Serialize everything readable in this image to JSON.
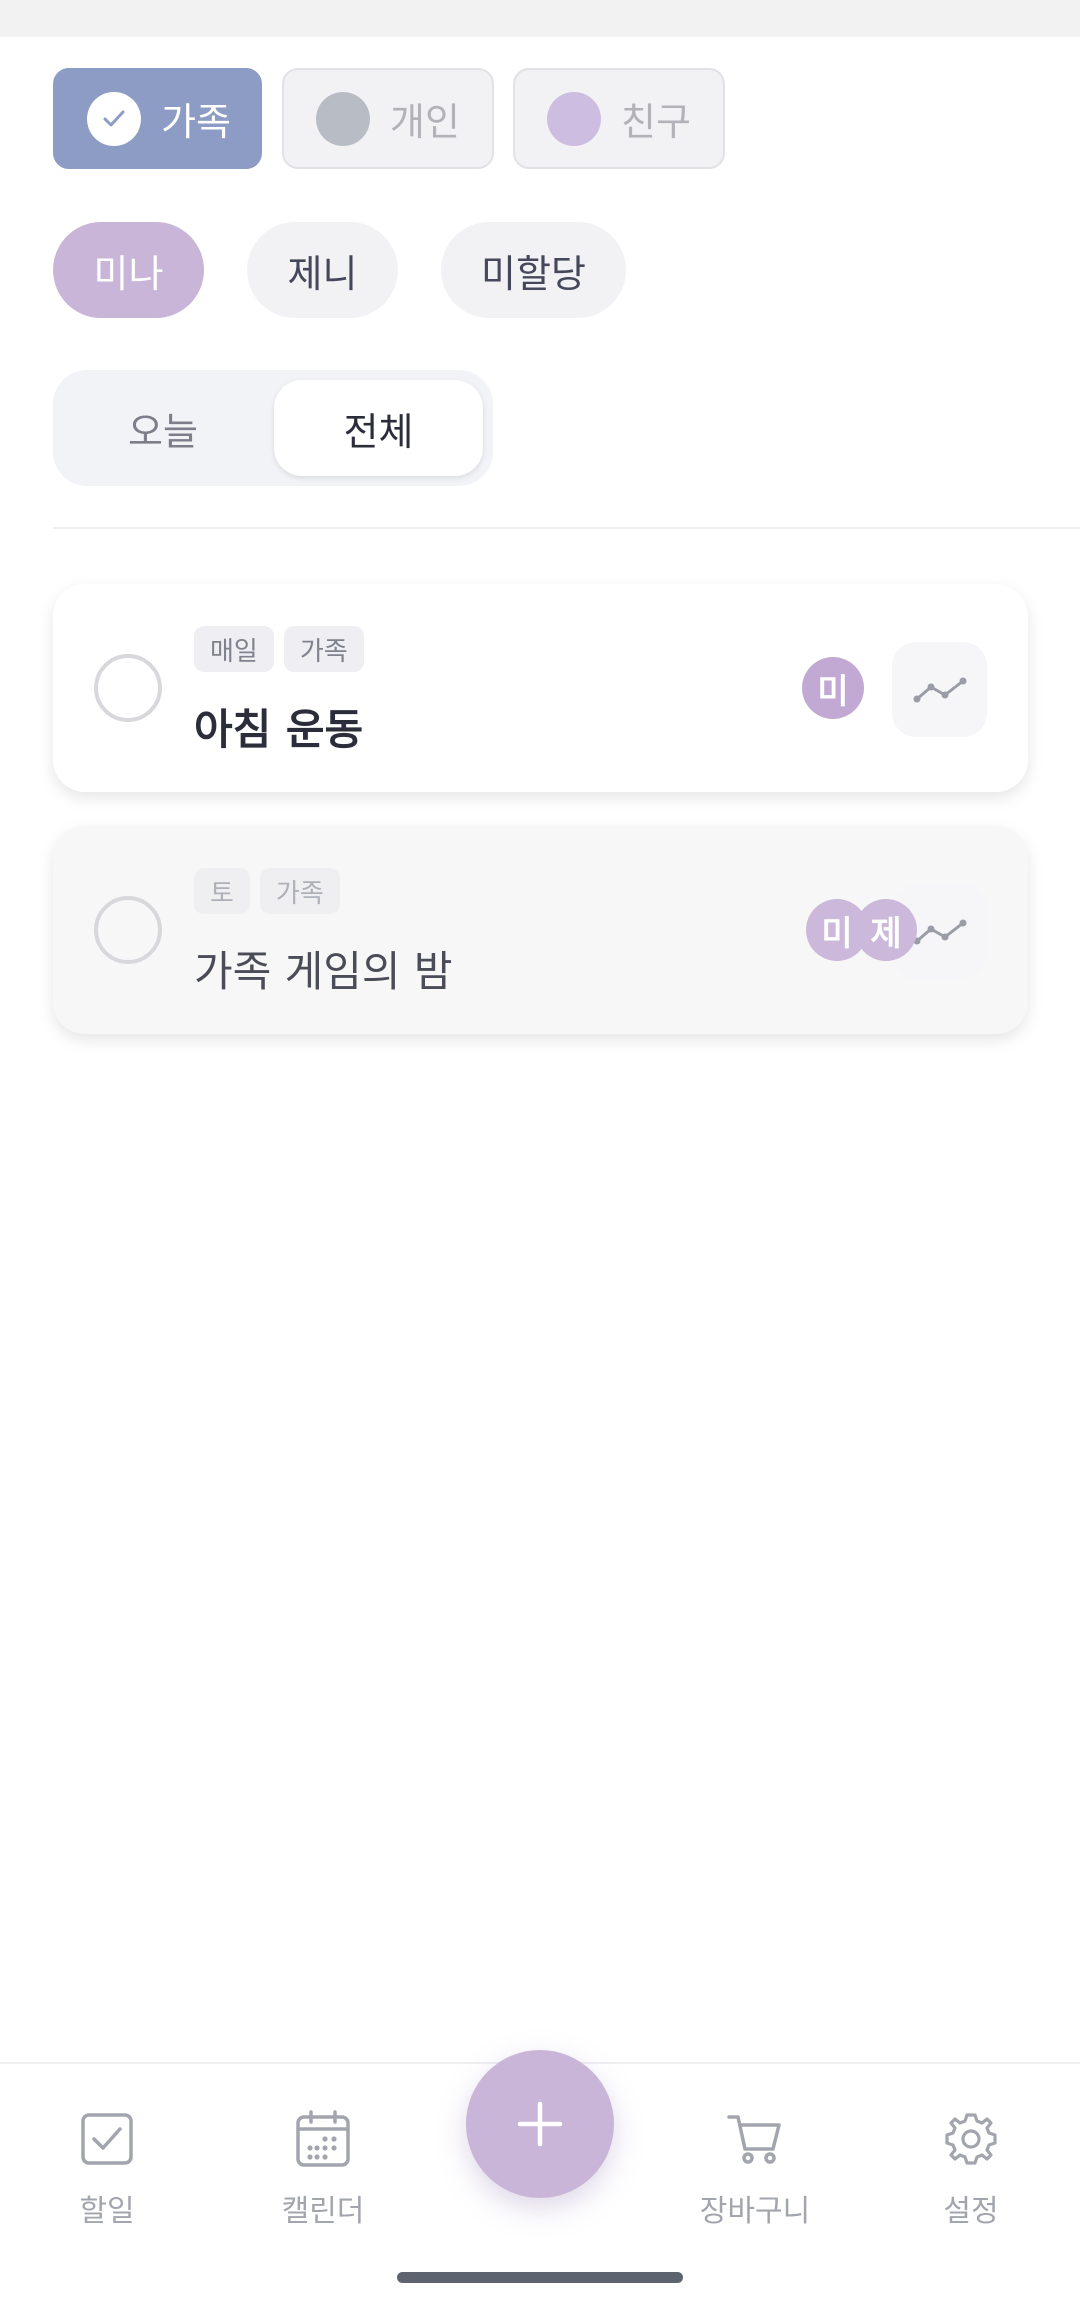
{
  "categories": [
    {
      "label": "가족",
      "state": "active",
      "dot_color": "#ffffff"
    },
    {
      "label": "개인",
      "state": "inactive",
      "dot_color": "#b8bcc4"
    },
    {
      "label": "친구",
      "state": "inactive",
      "dot_color": "#cdbde0"
    }
  ],
  "people": [
    {
      "label": "미나",
      "state": "active"
    },
    {
      "label": "제니",
      "state": "inactive"
    },
    {
      "label": "미할당",
      "state": "inactive"
    }
  ],
  "view_toggle": {
    "options": [
      "오늘",
      "전체"
    ],
    "selected": "전체"
  },
  "tasks": [
    {
      "tags": [
        "매일",
        "가족"
      ],
      "title": "아침 운동",
      "assignees": [
        "미"
      ],
      "completed": false
    },
    {
      "tags": [
        "토",
        "가족"
      ],
      "title": "가족 게임의 밤",
      "assignees": [
        "미",
        "제"
      ],
      "completed": false
    }
  ],
  "bottom_nav": {
    "items": [
      {
        "label": "할일",
        "icon": "checkbox-icon"
      },
      {
        "label": "캘린더",
        "icon": "calendar-icon"
      },
      {
        "label": "장바구니",
        "icon": "cart-icon"
      },
      {
        "label": "설정",
        "icon": "gear-icon"
      }
    ],
    "fab_icon": "plus-icon"
  },
  "colors": {
    "accent": "#c8b5d8",
    "category_active": "#8c9cc4",
    "text_primary": "#2b2d3a"
  }
}
